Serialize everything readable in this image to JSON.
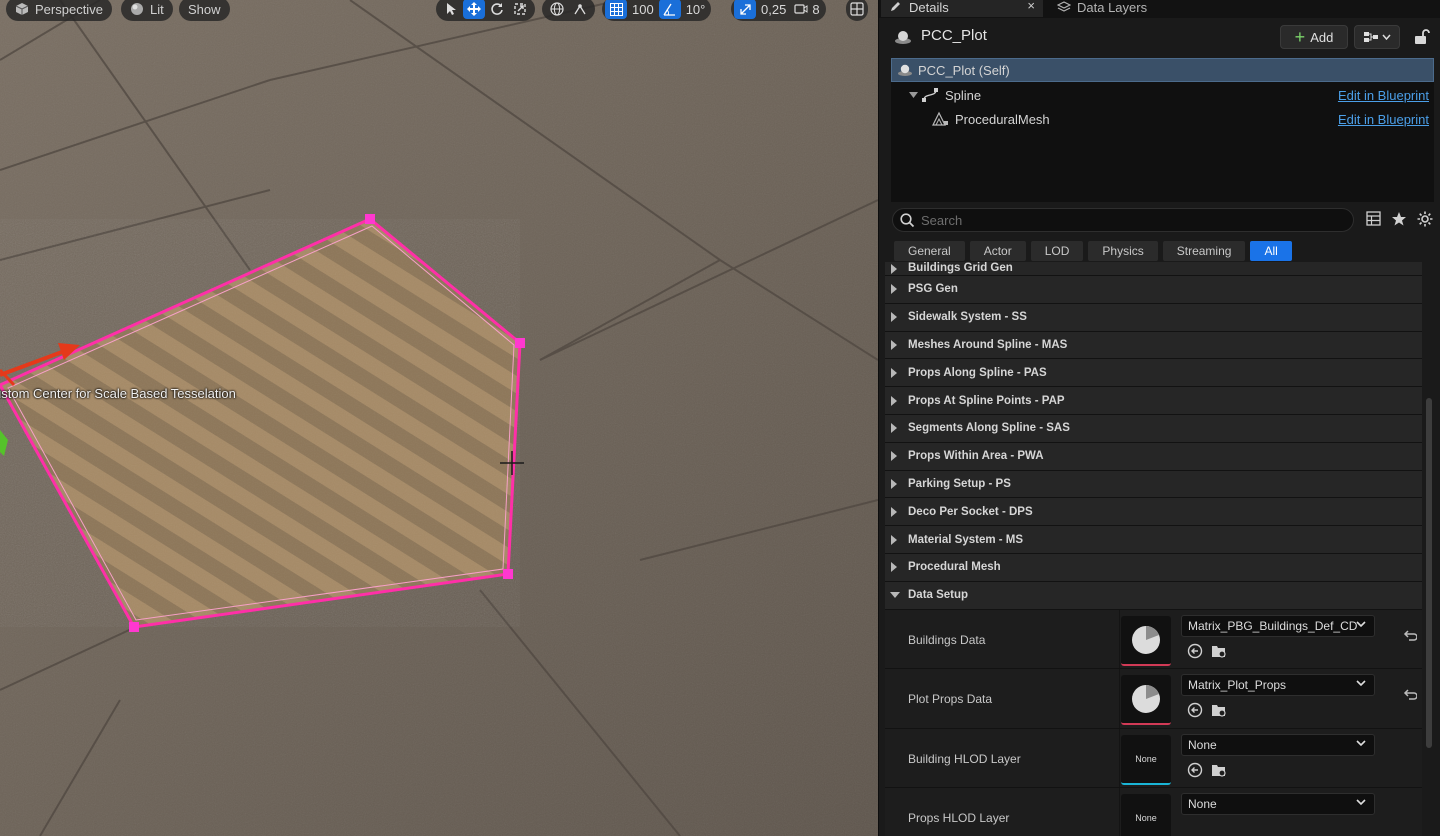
{
  "viewport": {
    "view_mode": "Perspective",
    "lighting": "Lit",
    "show": "Show",
    "grid_snap": "100",
    "rotation_snap": "10°",
    "scale_snap": "0,25",
    "camera_speed": "8",
    "overlay_label": "ustom Center for Scale Based Tesselation"
  },
  "details": {
    "tabs": [
      {
        "label": "Details",
        "close": "×"
      },
      {
        "label": "Data Layers"
      }
    ],
    "actor_name": "PCC_Plot",
    "add_label": "Add",
    "components": [
      {
        "label": "PCC_Plot (Self)"
      },
      {
        "label": "Spline",
        "link": "Edit in Blueprint"
      },
      {
        "label": "ProceduralMesh",
        "link": "Edit in Blueprint"
      }
    ],
    "search_placeholder": "Search",
    "filters": [
      "General",
      "Actor",
      "LOD",
      "Physics",
      "Streaming",
      "All"
    ],
    "active_filter": "All",
    "categories": [
      "Buildings Grid Gen",
      "PSG Gen",
      "Sidewalk System - SS",
      "Meshes Around Spline - MAS",
      "Props Along Spline - PAS",
      "Props At Spline Points - PAP",
      "Segments Along Spline - SAS",
      "Props Within Area - PWA",
      "Parking Setup - PS",
      "Deco Per Socket - DPS",
      "Material System - MS",
      "Procedural Mesh",
      "Data Setup"
    ],
    "properties": [
      {
        "label": "Buildings Data",
        "value": "Matrix_PBG_Buildings_Def_CD",
        "thumb": "pie"
      },
      {
        "label": "Plot Props Data",
        "value": "Matrix_Plot_Props",
        "thumb": "pie"
      },
      {
        "label": "Building HLOD Layer",
        "value": "None",
        "thumb": "None"
      },
      {
        "label": "Props HLOD Layer",
        "value": "None",
        "thumb": "None"
      }
    ]
  },
  "colors": {
    "accent": "#1a73e8",
    "link": "#4b9fe8",
    "selection": "#3a5068",
    "spline": "#ff2fa8"
  }
}
